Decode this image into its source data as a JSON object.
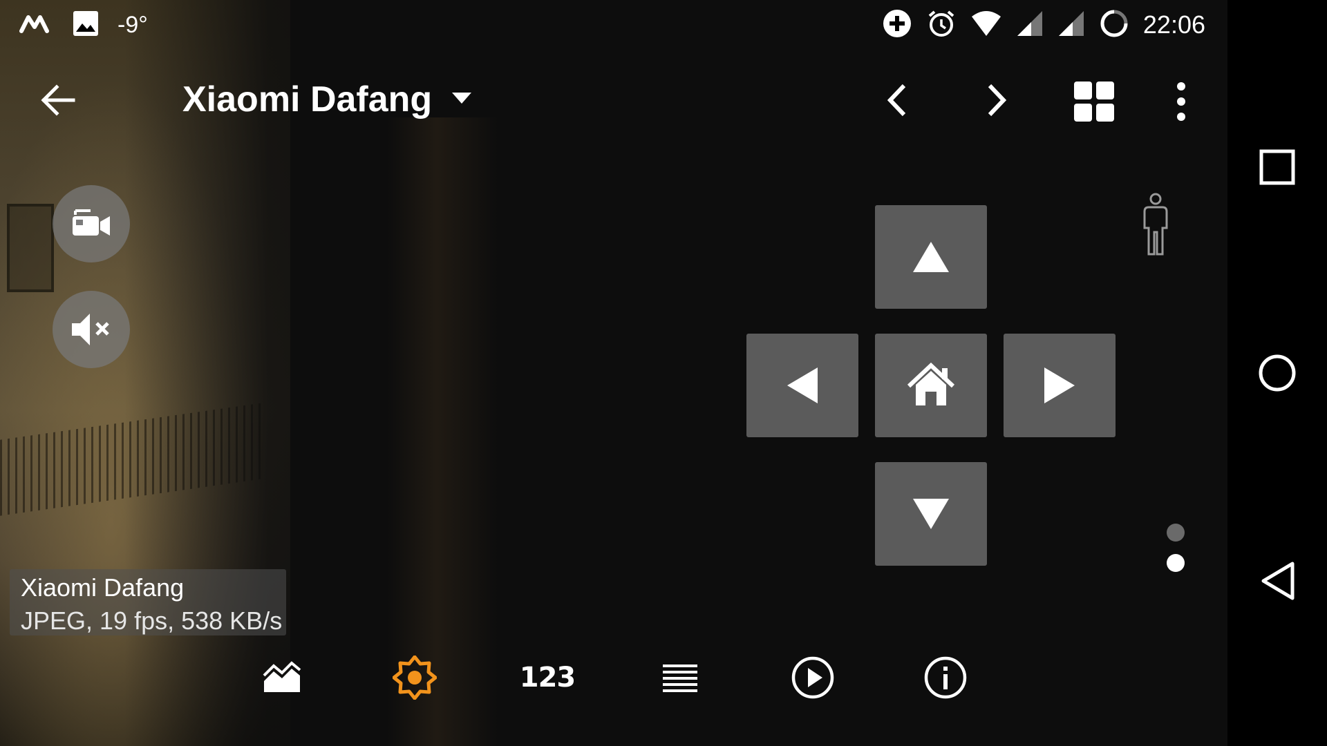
{
  "status_bar": {
    "temperature": "-9°",
    "time": "22:06",
    "icons": [
      "m-logo-icon",
      "image-icon",
      "add-circle-icon",
      "alarm-icon",
      "wifi-icon",
      "signal-icon",
      "signal-icon",
      "sync-icon"
    ]
  },
  "app_bar": {
    "title": "Xiaomi Dafang",
    "icons": [
      "back-arrow-icon",
      "dropdown-caret-icon",
      "chevron-left-icon",
      "chevron-right-icon",
      "grid-view-icon",
      "more-vert-icon"
    ]
  },
  "overlay_buttons": {
    "record_icon": "video-record-icon",
    "mute_icon": "volume-off-icon"
  },
  "ptz": {
    "buttons": [
      "up",
      "left",
      "home",
      "right",
      "down"
    ]
  },
  "caption": {
    "camera_name": "Xiaomi Dafang",
    "stream_info": "JPEG, 19 fps, 538 KB/s"
  },
  "toolbar": {
    "numbers_label": "123",
    "icons": [
      "landscape-icon",
      "brightness-icon",
      "numbers-icon",
      "list-icon",
      "play-circle-icon",
      "info-icon"
    ],
    "accent_color": "#f2931c"
  },
  "page_indicator": {
    "pages": 2,
    "active": 2
  },
  "system_nav": {
    "icons": [
      "recents-square-icon",
      "home-circle-icon",
      "back-triangle-icon"
    ]
  }
}
